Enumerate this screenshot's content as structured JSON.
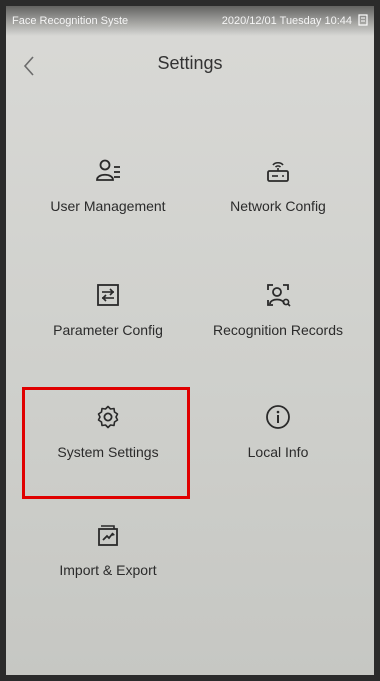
{
  "statusbar": {
    "app_name": "Face Recognition Syste",
    "datetime": "2020/12/01 Tuesday 10:44"
  },
  "header": {
    "title": "Settings"
  },
  "menu": {
    "items": [
      {
        "label": "User Management",
        "icon": "user-list-icon"
      },
      {
        "label": "Network Config",
        "icon": "router-icon"
      },
      {
        "label": "Parameter Config",
        "icon": "parameter-icon"
      },
      {
        "label": "Recognition Records",
        "icon": "face-scan-icon"
      },
      {
        "label": "System Settings",
        "icon": "gear-icon"
      },
      {
        "label": "Local Info",
        "icon": "info-icon"
      },
      {
        "label": "Import & Export",
        "icon": "import-export-icon"
      }
    ]
  },
  "highlight": {
    "target": "System Settings",
    "color": "#e00000"
  }
}
